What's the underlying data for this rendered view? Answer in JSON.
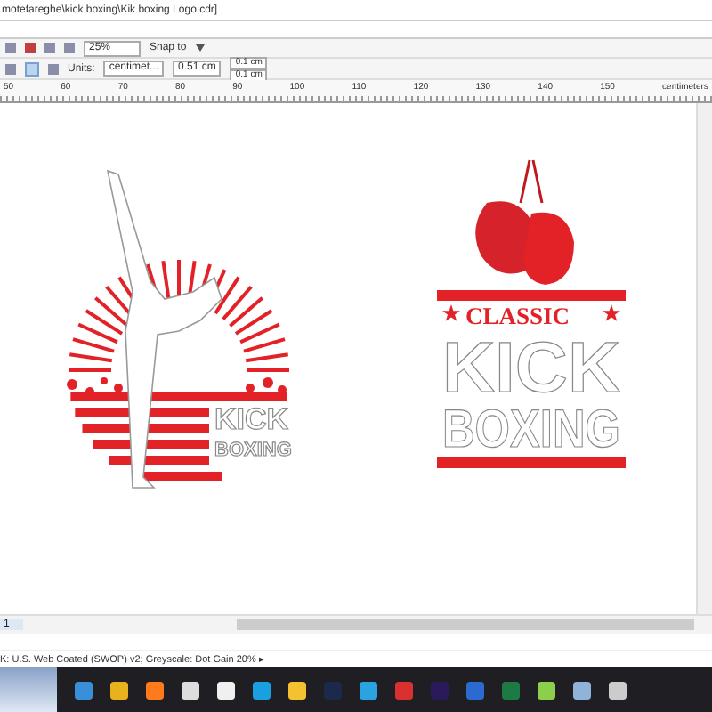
{
  "window": {
    "title": "motefareghe\\kick boxing\\Kik boxing  Logo.cdr]"
  },
  "toolbar": {
    "zoom": "25%",
    "snap": "Snap to"
  },
  "property_bar": {
    "units_label": "Units:",
    "units": "centimet...",
    "nudge": "0.51 cm",
    "dup_x": "0.1 cm",
    "dup_y": "0.1 cm"
  },
  "ruler": {
    "ticks": [
      "50",
      "60",
      "70",
      "80",
      "90",
      "100",
      "110",
      "120",
      "130",
      "140",
      "150"
    ],
    "unit": "centimeters"
  },
  "artwork": {
    "left_logo": {
      "line_1": "KICK",
      "line_2": "BOXING"
    },
    "right_logo": {
      "line_1": "CLASSIC",
      "line_2": "KICK",
      "line_3": "BOXING"
    }
  },
  "page_tabs": [
    {
      "label": "1",
      "selected": true
    }
  ],
  "status_bar": {
    "text": "K: U.S. Web Coated (SWOP) v2; Greyscale: Dot Gain 20% ▸"
  }
}
